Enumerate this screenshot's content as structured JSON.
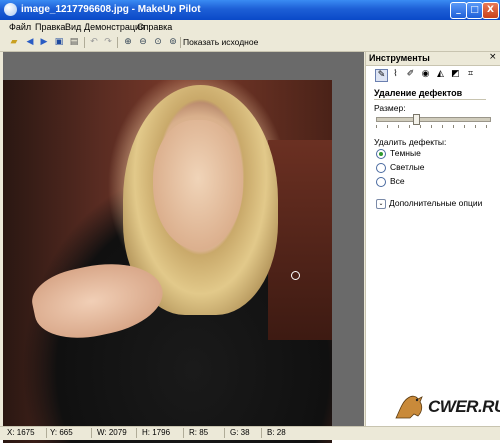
{
  "window": {
    "title": "image_1217796608.jpg - MakeUp Pilot",
    "minimize": "_",
    "maximize": "□",
    "close": "X"
  },
  "menu": [
    "Файл",
    "Правка",
    "Вид",
    "Демонстрация",
    "Справка"
  ],
  "toolbar": {
    "show_original_label": "Показать исходное",
    "icons": [
      "open-icon",
      "back-arrow-icon",
      "forward-arrow-icon",
      "save-icon",
      "print-icon",
      "undo-icon",
      "redo-icon",
      "zoom-in-icon",
      "zoom-out-icon",
      "zoom-fit-icon",
      "zoom-actual-icon"
    ]
  },
  "tools_panel": {
    "title": "Инструменты",
    "close": "×",
    "section_title": "Удаление дефектов",
    "size_label": "Размер:",
    "size_value": 0.34,
    "remove_label": "Удалить дефекты:",
    "options": [
      {
        "label": "Темные",
        "selected": true
      },
      {
        "label": "Светлые",
        "selected": false
      },
      {
        "label": "Все",
        "selected": false
      }
    ],
    "extra_options_label": "Дополнительные опции",
    "watermark": "CWER.RU"
  },
  "status": {
    "x": "X: 1675",
    "y": "Y: 665",
    "w": "W: 2079",
    "h": "H: 1796",
    "r": "R: 85",
    "g": "G: 38",
    "b": "B: 28"
  },
  "colors": {
    "titlebar": "#0a49c8",
    "panel_bg": "#ffffff",
    "chrome_bg": "#ece9d8",
    "canvas_bg": "#6a6a6a",
    "radio_selected": "#2f9a2f"
  }
}
